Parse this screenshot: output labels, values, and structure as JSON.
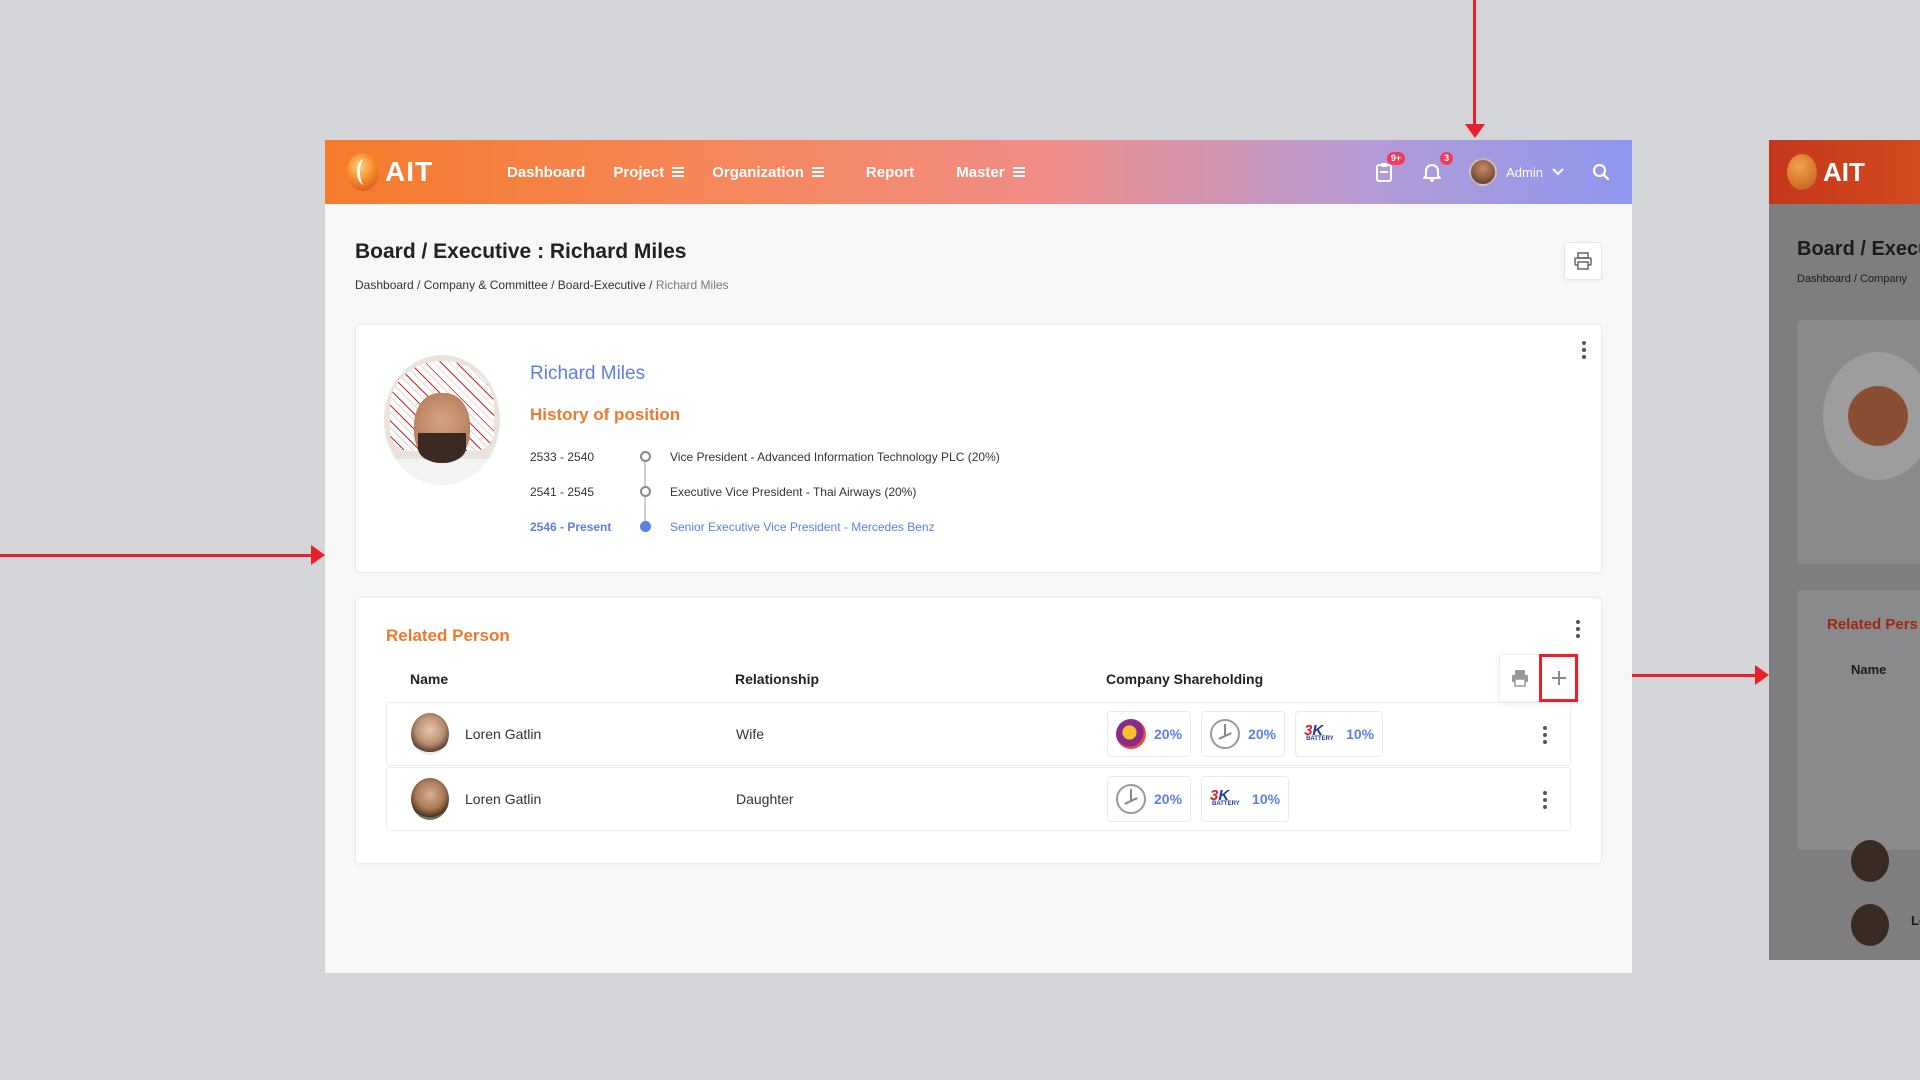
{
  "app": {
    "logo_text": "AIT",
    "nav": [
      {
        "label": "Dashboard",
        "has_menu": false
      },
      {
        "label": "Project",
        "has_menu": true
      },
      {
        "label": "Organization",
        "has_menu": true
      },
      {
        "label": "Report",
        "has_menu": false
      },
      {
        "label": "Master",
        "has_menu": true
      }
    ],
    "clipboard_badge": "9+",
    "notification_badge": "3",
    "user_name": "Admin"
  },
  "page": {
    "title": "Board / Executive : Richard Miles",
    "breadcrumb": [
      "Dashboard",
      "Company & Committee",
      "Board-Executive",
      "Richard Miles"
    ]
  },
  "profile": {
    "name": "Richard Miles",
    "history_title": "History of position",
    "history": [
      {
        "years": "2533 - 2540",
        "position": "Vice President - Advanced Information Technology PLC (20%)",
        "current": false
      },
      {
        "years": "2541 - 2545",
        "position": "Executive Vice President - Thai Airways (20%)",
        "current": false
      },
      {
        "years": "2546 - Present",
        "position": "Senior Executive Vice President - Mercedes Benz",
        "current": true
      }
    ]
  },
  "related": {
    "title": "Related Person",
    "columns": {
      "name": "Name",
      "relationship": "Relationship",
      "shareholding": "Company Shareholding"
    },
    "rows": [
      {
        "name": "Loren Gatlin",
        "relationship": "Wife",
        "shares": [
          {
            "company_icon": "thai-airways-logo",
            "percent": "20%"
          },
          {
            "company_icon": "mercedes-logo",
            "percent": "20%"
          },
          {
            "company_icon": "3k-battery-logo",
            "percent": "10%"
          }
        ]
      },
      {
        "name": "Loren Gatlin",
        "relationship": "Daughter",
        "shares": [
          {
            "company_icon": "mercedes-logo",
            "percent": "20%"
          },
          {
            "company_icon": "3k-battery-logo",
            "percent": "10%"
          }
        ]
      }
    ]
  },
  "preview": {
    "logo_text": "AIT",
    "title": "Board / Execu",
    "breadcrumb": "Dashboard / Company",
    "related_title": "Related Pers",
    "name_col": "Name",
    "row2_name": "Lo"
  },
  "colors": {
    "accent_orange": "#f0782e",
    "link_blue": "#5b7fe6",
    "annotation_red": "#e8202a"
  }
}
